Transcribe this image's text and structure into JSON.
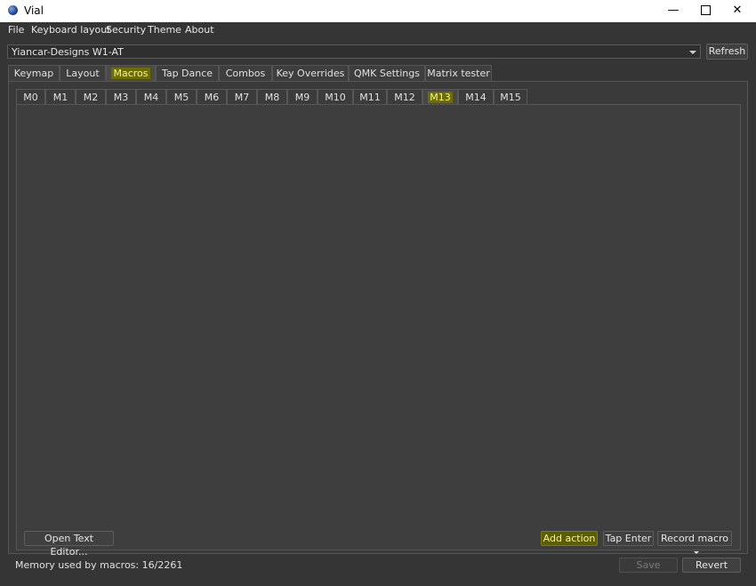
{
  "window": {
    "title": "Vial",
    "minimize_glyph": "—",
    "close_glyph": "✕"
  },
  "menu": [
    "File",
    "Keyboard layout",
    "Security",
    "Theme",
    "About"
  ],
  "device": {
    "selected": "Yiancar-Designs W1-AT",
    "refresh_label": "Refresh"
  },
  "main_tabs": [
    "Keymap",
    "Layout",
    "Macros",
    "Tap Dance",
    "Combos",
    "Key Overrides",
    "QMK Settings",
    "Matrix tester"
  ],
  "active_main_tab": "Macros",
  "macro_tabs": [
    "M0",
    "M1",
    "M2",
    "M3",
    "M4",
    "M5",
    "M6",
    "M7",
    "M8",
    "M9",
    "M10",
    "M11",
    "M12",
    "M13",
    "M14",
    "M15"
  ],
  "active_macro_tab": "M13",
  "editor": {
    "open_text_editor_label": "Open Text Editor...",
    "add_action_label": "Add action",
    "tap_enter_label": "Tap Enter",
    "record_macro_label": "Record macro"
  },
  "footer": {
    "memory_text": "Memory used by macros: 16/2261",
    "save_label": "Save",
    "revert_label": "Revert"
  },
  "colors": {
    "background": "#353535",
    "highlight": "#6e6e00",
    "highlight_text": "#f5f59a"
  },
  "icons": {
    "app": "vial-logo-icon",
    "dropdown": "chevron-down-icon",
    "record_caret": "caret-down-icon"
  }
}
